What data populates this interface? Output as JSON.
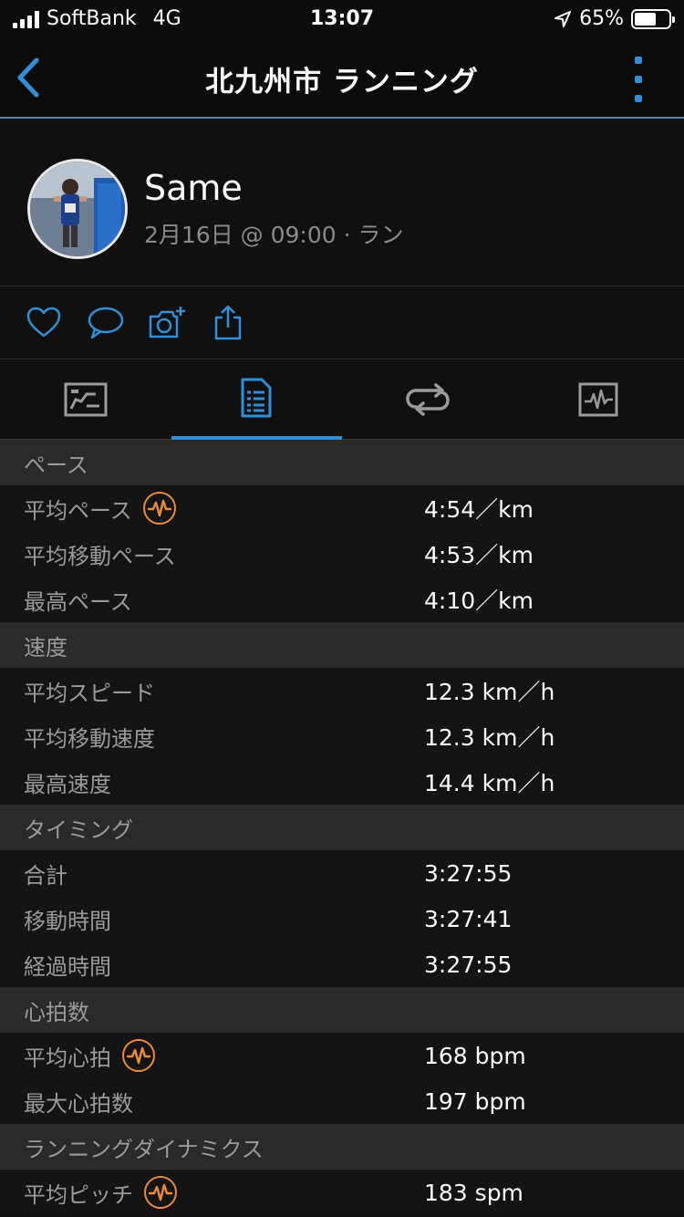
{
  "status_bar": {
    "carrier": "SoftBank",
    "network": "4G",
    "time": "13:07",
    "battery": "65%",
    "battery_level": 0.65
  },
  "nav": {
    "title": "北九州市 ランニング",
    "back_icon": "chevron-left-icon",
    "more_icon": "vertical-ellipsis-icon"
  },
  "profile": {
    "name": "Same",
    "subtitle": "2月16日 @ 09:00 · ラン"
  },
  "actions": [
    "heart-icon",
    "comment-icon",
    "add-photo-icon",
    "share-icon"
  ],
  "tabs": [
    {
      "icon": "overview-card-icon",
      "active": false
    },
    {
      "icon": "stats-list-icon",
      "active": true
    },
    {
      "icon": "laps-loop-icon",
      "active": false
    },
    {
      "icon": "chart-icon",
      "active": false
    }
  ],
  "colors": {
    "accent": "#2f8fd8",
    "hr_badge": "#e98a36"
  },
  "sections": [
    {
      "title": "ペース",
      "rows": [
        {
          "label": "平均ペース",
          "value": "4:54／km",
          "badge": true
        },
        {
          "label": "平均移動ペース",
          "value": "4:53／km",
          "badge": false
        },
        {
          "label": "最高ペース",
          "value": "4:10／km",
          "badge": false
        }
      ]
    },
    {
      "title": "速度",
      "rows": [
        {
          "label": "平均スピード",
          "value": "12.3 km／h",
          "badge": false
        },
        {
          "label": "平均移動速度",
          "value": "12.3 km／h",
          "badge": false
        },
        {
          "label": "最高速度",
          "value": "14.4 km／h",
          "badge": false
        }
      ]
    },
    {
      "title": "タイミング",
      "rows": [
        {
          "label": "合計",
          "value": "3:27:55",
          "badge": false
        },
        {
          "label": "移動時間",
          "value": "3:27:41",
          "badge": false
        },
        {
          "label": "経過時間",
          "value": "3:27:55",
          "badge": false
        }
      ]
    },
    {
      "title": "心拍数",
      "rows": [
        {
          "label": "平均心拍",
          "value": "168 bpm",
          "badge": true
        },
        {
          "label": "最大心拍数",
          "value": "197 bpm",
          "badge": false
        }
      ]
    },
    {
      "title": "ランニングダイナミクス",
      "rows": [
        {
          "label": "平均ピッチ",
          "value": "183 spm",
          "badge": true
        }
      ]
    }
  ]
}
